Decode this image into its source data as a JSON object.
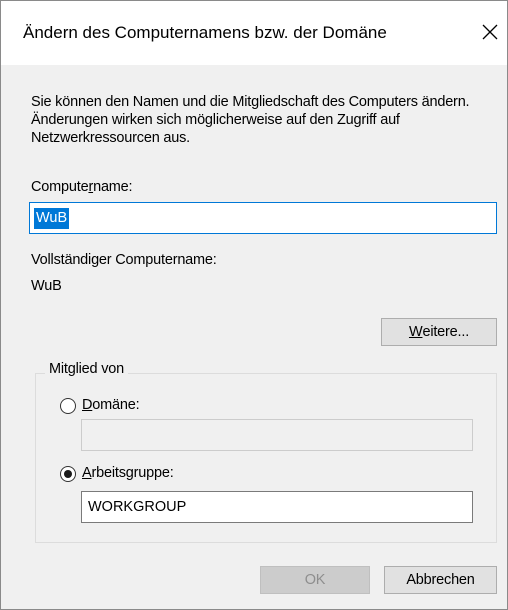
{
  "dialog": {
    "title": "Ändern des Computernamens bzw. der Domäne",
    "description": "Sie können den Namen und die Mitgliedschaft des Computers ändern. Änderungen wirken sich möglicherweise auf den Zugriff auf Netzwerkressourcen aus."
  },
  "computername": {
    "label_before": "Compute",
    "label_hotkey": "r",
    "label_after": "name:",
    "value": "WuB"
  },
  "full_name": {
    "label": "Vollständiger Computername:",
    "value": "WuB"
  },
  "more_button": {
    "hotkey": "W",
    "rest": "eitere..."
  },
  "member_of": {
    "legend": "Mitglied von",
    "domain": {
      "hotkey": "D",
      "rest": "omäne:",
      "value": "",
      "selected": false
    },
    "workgroup": {
      "hotkey": "A",
      "rest": "rbeitsgruppe:",
      "value": "WORKGROUP",
      "selected": true
    }
  },
  "footer": {
    "ok_label": "OK",
    "cancel_label": "Abbrechen"
  },
  "colors": {
    "accent": "#0078d7",
    "dialog_background": "#f0f0f0"
  },
  "icons": {
    "close": "close-icon"
  }
}
